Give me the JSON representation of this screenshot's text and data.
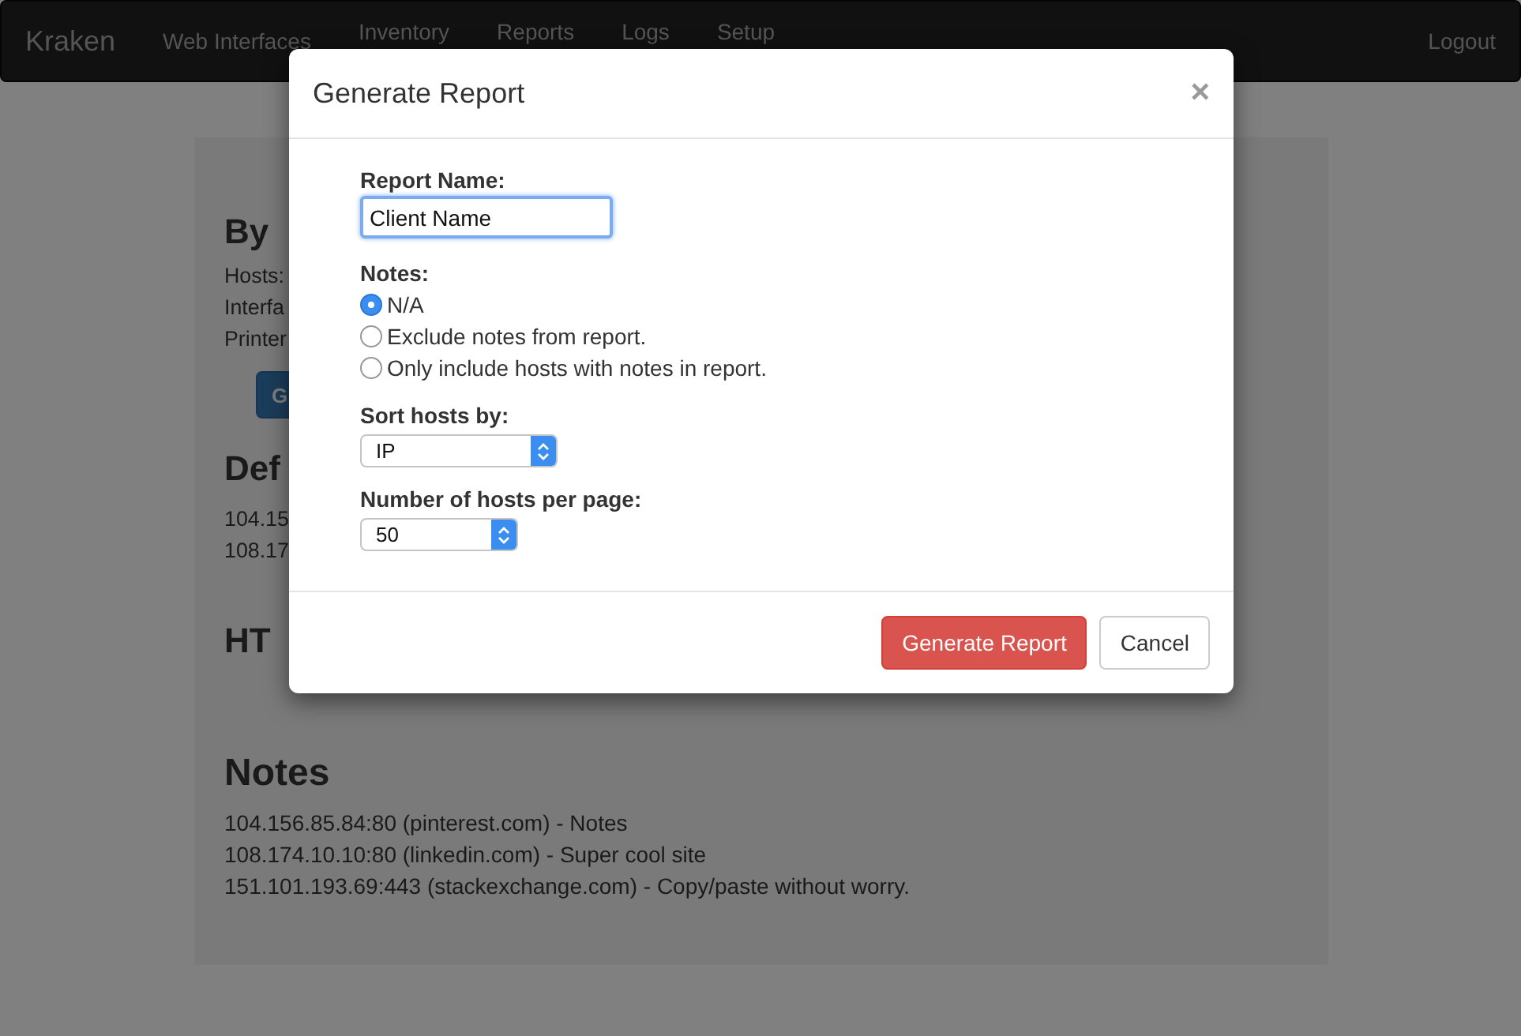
{
  "navbar": {
    "brand": "Kraken",
    "links": [
      {
        "label": "Web Interfaces"
      },
      {
        "label": "Inventory"
      },
      {
        "label": "Reports"
      },
      {
        "label": "Logs"
      },
      {
        "label": "Setup"
      }
    ],
    "logout": "Logout"
  },
  "page": {
    "sections": [
      {
        "heading": "By",
        "lines": [
          "Hosts:",
          "Interfa",
          "Printer"
        ],
        "button": "G"
      },
      {
        "heading": "Def",
        "lines": [
          "104.15",
          "108.17"
        ]
      },
      {
        "heading": "HT"
      },
      {
        "heading": "Notes",
        "lines": [
          "104.156.85.84:80 (pinterest.com) - Notes",
          "108.174.10.10:80 (linkedin.com) - Super cool site",
          "151.101.193.69:443 (stackexchange.com) - Copy/paste without worry."
        ]
      }
    ]
  },
  "modal": {
    "title": "Generate Report",
    "close": "×",
    "report_name": {
      "label": "Report Name:",
      "value": "Client Name",
      "focused": true
    },
    "notes": {
      "label": "Notes:",
      "options": [
        {
          "label": "N/A",
          "selected": true
        },
        {
          "label": "Exclude notes from report.",
          "selected": false
        },
        {
          "label": "Only include hosts with notes in report.",
          "selected": false
        }
      ]
    },
    "sort_by": {
      "label": "Sort hosts by:",
      "value": "IP"
    },
    "per_page": {
      "label": "Number of hosts per page:",
      "value": "50"
    },
    "buttons": [
      {
        "label": "Generate Report",
        "kind": "danger"
      },
      {
        "label": "Cancel",
        "kind": "default"
      }
    ]
  }
}
